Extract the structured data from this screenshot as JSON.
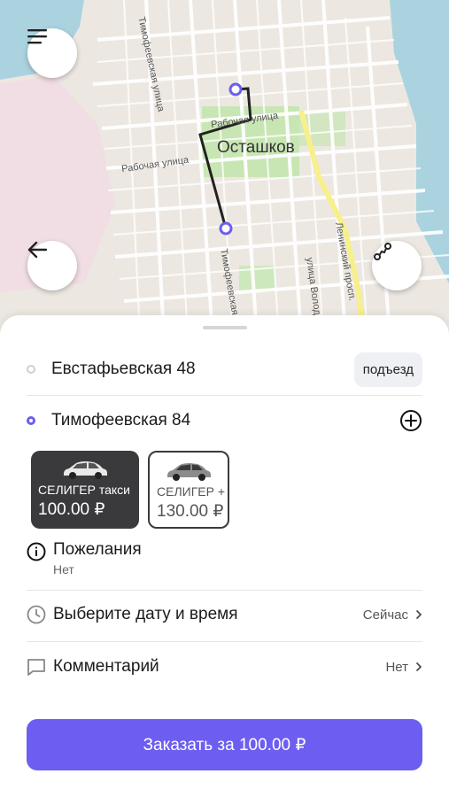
{
  "map": {
    "city_label": "Осташков",
    "street_labels": {
      "timofeevskaya_upper": "Тимофеевская улица",
      "timofeevskaya_lower": "Тимофеевская улица",
      "rabochaya_left": "Рабочая улица",
      "rabochaya_right": "Рабочая улица",
      "leninsky": "Ленинский просп.",
      "volodarskogo": "улица Володарского"
    },
    "menu_icon": "hamburger-menu-icon",
    "back_icon": "arrow-left-icon",
    "route_icon": "route-icon",
    "route_color": "#222222",
    "pin_color": "#6c5ef0"
  },
  "addresses": {
    "from": "Евстафьевская 48",
    "to": "Тимофеевская 84",
    "entrance_button": "подъезд"
  },
  "tariffs": [
    {
      "name": "СЕЛИГЕР такси",
      "price": "100.00 ₽",
      "selected": true
    },
    {
      "name": "СЕЛИГЕР +",
      "price": "130.00 ₽",
      "selected": false
    }
  ],
  "options": {
    "wishes_title": "Пожелания",
    "wishes_value": "Нет",
    "datetime_title": "Выберите дату и время",
    "datetime_value": "Сейчас",
    "comment_title": "Комментарий",
    "comment_value": "Нет"
  },
  "order_button": "Заказать за 100.00 ₽",
  "colors": {
    "accent": "#6c5ef0",
    "selected_tariff_bg": "#3a3a3c"
  }
}
